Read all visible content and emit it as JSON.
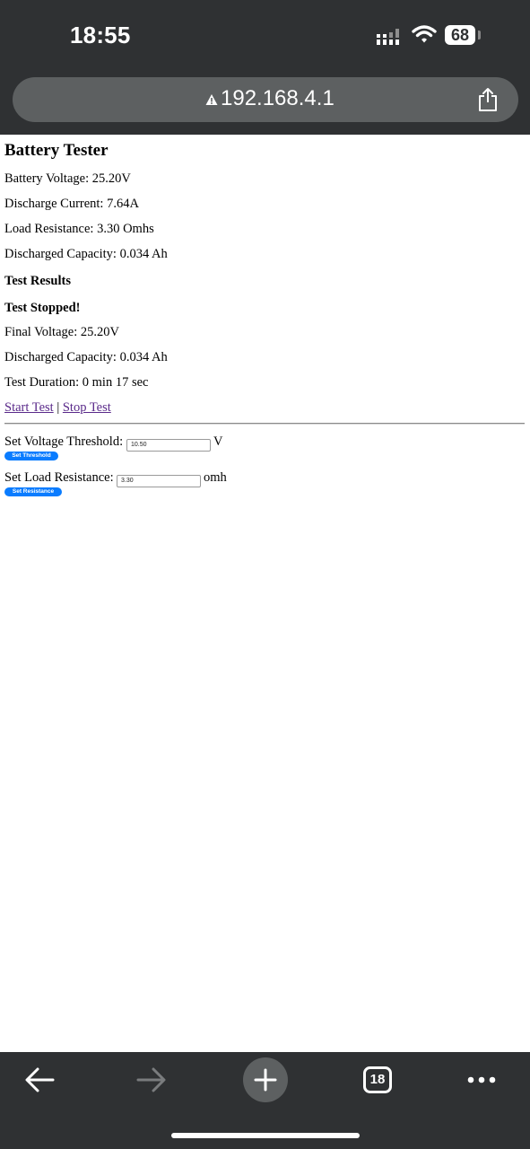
{
  "status_bar": {
    "time": "18:55",
    "battery": "68"
  },
  "browser": {
    "url": "192.168.4.1",
    "tab_count": "18"
  },
  "page": {
    "title": "Battery Tester",
    "readings": {
      "battery_voltage": "Battery Voltage: 25.20V",
      "discharge_current": "Discharge Current: 7.64A",
      "load_resistance": "Load Resistance: 3.30 Omhs",
      "discharged_capacity": "Discharged Capacity: 0.034 Ah"
    },
    "results": {
      "heading": "Test Results",
      "status": "Test Stopped!",
      "final_voltage": "Final Voltage: 25.20V",
      "discharged_capacity": "Discharged Capacity: 0.034 Ah",
      "duration": "Test Duration: 0 min 17 sec"
    },
    "links": {
      "start": "Start Test",
      "separator": "|",
      "stop": "Stop Test"
    },
    "threshold_form": {
      "label": "Set Voltage Threshold:",
      "value": "10.50",
      "unit": "V",
      "button": "Set Threshold"
    },
    "resistance_form": {
      "label": "Set Load Resistance:",
      "value": "3.30",
      "unit": "omh",
      "button": "Set Resistance"
    }
  },
  "icons": {
    "status": [
      "signal-icon",
      "wifi-icon",
      "battery-icon"
    ],
    "url_bar": [
      "warning-icon",
      "share-icon"
    ],
    "toolbar": [
      "back-icon",
      "forward-icon",
      "new-tab-icon",
      "tabs-icon",
      "more-icon"
    ]
  },
  "colors": {
    "chrome": "#2f3133",
    "url_bar": "#5d6061",
    "link": "#5a2a8a",
    "button": "#0a7cff"
  }
}
